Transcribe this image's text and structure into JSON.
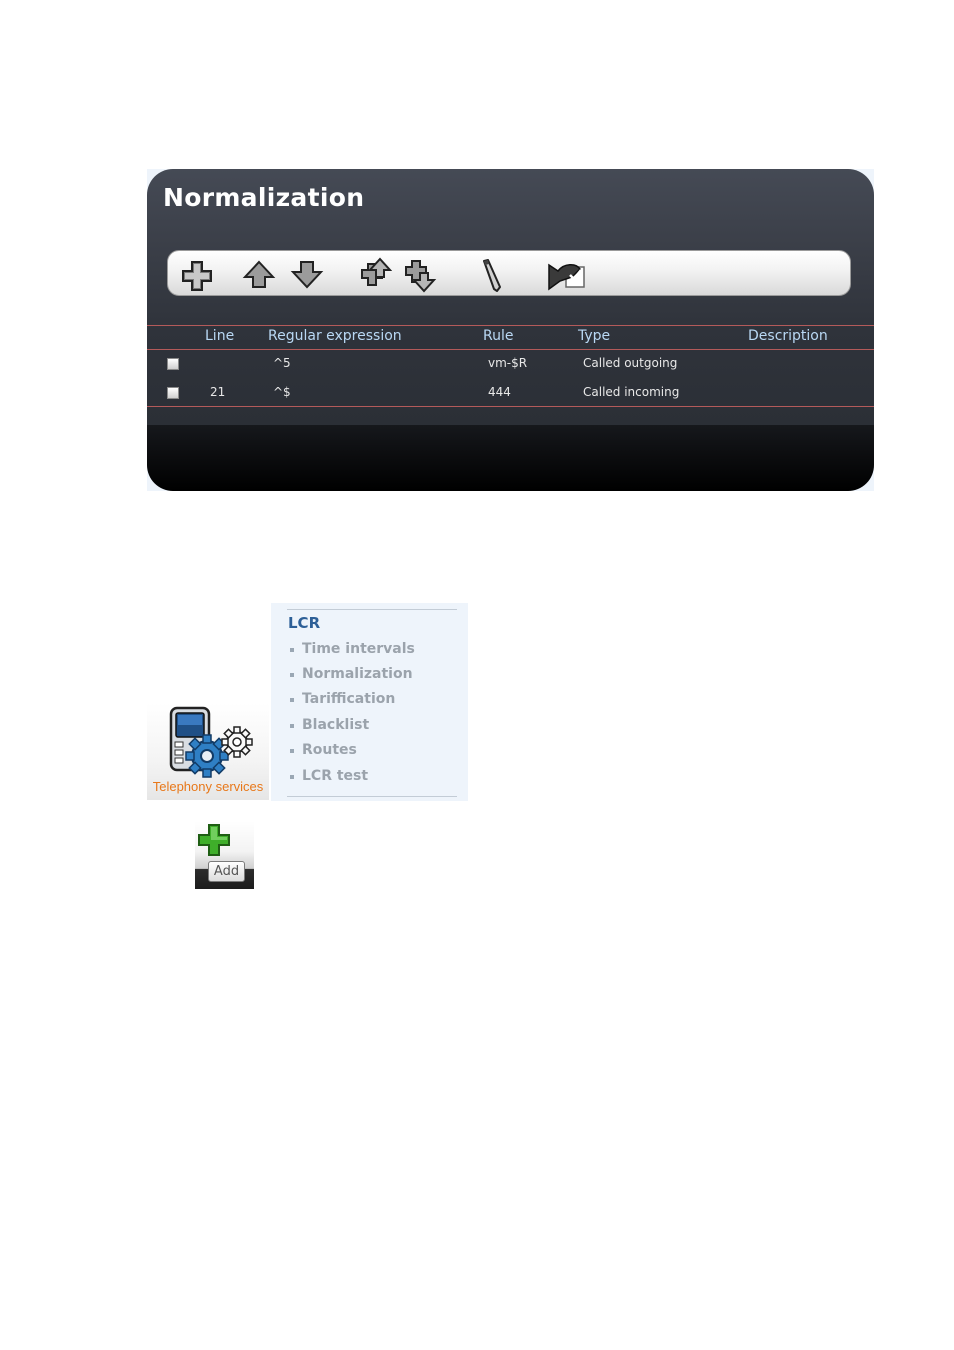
{
  "panel": {
    "title": "Normalization",
    "toolbar": {
      "buttons": [
        "add-icon",
        "move-up-icon",
        "move-down-icon",
        "move-to-top-icon",
        "move-to-bottom-icon",
        "edit-pencil-icon",
        "apply-changes-icon"
      ]
    },
    "table": {
      "headers": [
        "Line",
        "Regular expression",
        "Rule",
        "Type",
        "Description"
      ],
      "rows": [
        {
          "line": "",
          "regex": "^5",
          "rule": "vm-$R",
          "type": "Called outgoing",
          "description": ""
        },
        {
          "line": "21",
          "regex": "^$",
          "rule": "444",
          "type": "Called incoming",
          "description": ""
        }
      ]
    }
  },
  "telephony": {
    "label": "Telephony services",
    "icon": "phone-with-gears-icon"
  },
  "lcr_menu": {
    "title": "LCR",
    "items": [
      "Time intervals",
      "Normalization",
      "Tariffication",
      "Blacklist",
      "Routes",
      "LCR test"
    ]
  },
  "add_button": {
    "label": "Add",
    "icon": "green-plus-icon"
  },
  "colors": {
    "header_text": "#b9d8f4",
    "row_divider": "#b45a5a",
    "lcr_title": "#2d5f97",
    "telephony_label": "#e8781a",
    "add_plus": "#3fae2a"
  }
}
